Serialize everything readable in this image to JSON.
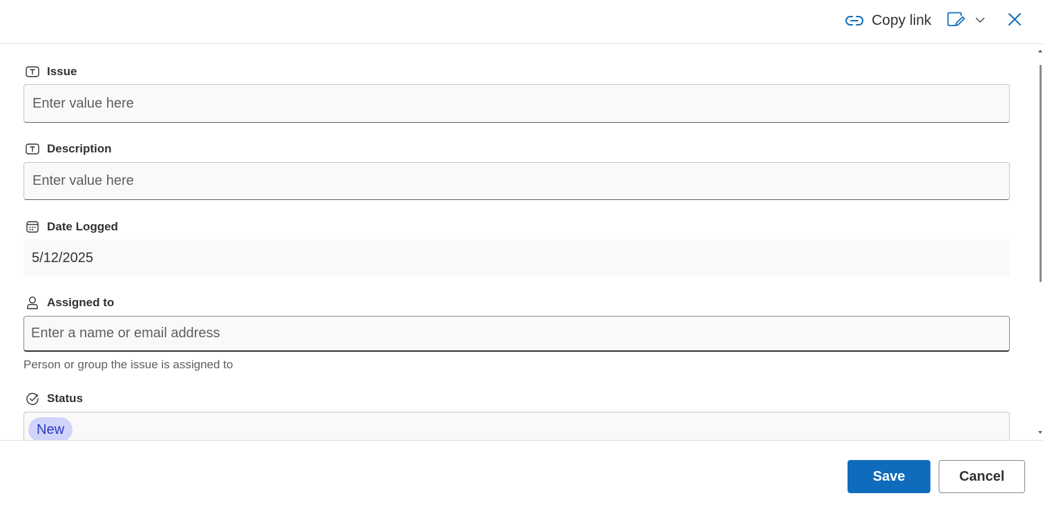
{
  "header": {
    "copy_link_label": "Copy link",
    "icons": [
      "link-icon",
      "edit-view-icon",
      "chevron-down-icon",
      "close-icon"
    ]
  },
  "form": {
    "issue": {
      "label": "Issue",
      "placeholder": "Enter value here",
      "icon": "text-field-icon"
    },
    "description": {
      "label": "Description",
      "placeholder": "Enter value here",
      "icon": "text-field-icon"
    },
    "date_logged": {
      "label": "Date Logged",
      "value": "5/12/2025",
      "icon": "calendar-icon"
    },
    "assigned_to": {
      "label": "Assigned to",
      "placeholder": "Enter a name or email address",
      "help": "Person or group the issue is assigned to",
      "icon": "person-icon"
    },
    "status": {
      "label": "Status",
      "value": "New",
      "icon": "status-check-icon"
    }
  },
  "footer": {
    "save_label": "Save",
    "cancel_label": "Cancel"
  },
  "colors": {
    "accent": "#0f6cbd",
    "pill_bg": "#d1d4fa",
    "pill_text": "#2b3bbf",
    "field_bg": "#faf9f8"
  }
}
